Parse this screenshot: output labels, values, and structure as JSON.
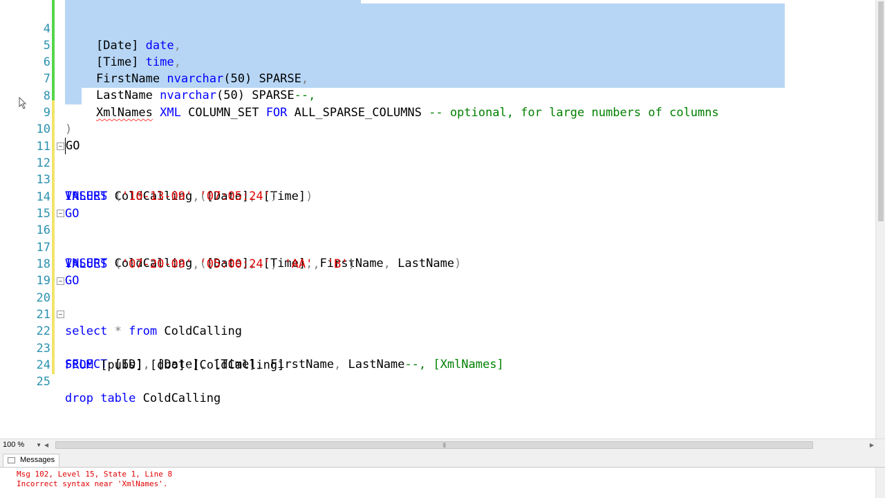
{
  "editor": {
    "lines": [
      {
        "num": "4",
        "top": true
      },
      {
        "num": "5"
      },
      {
        "num": "6"
      },
      {
        "num": "7"
      },
      {
        "num": "8"
      },
      {
        "num": "9"
      },
      {
        "num": "10"
      },
      {
        "num": "11"
      },
      {
        "num": "12"
      },
      {
        "num": "13"
      },
      {
        "num": "14"
      },
      {
        "num": "15"
      },
      {
        "num": "16"
      },
      {
        "num": "17"
      },
      {
        "num": "18"
      },
      {
        "num": "19"
      },
      {
        "num": "20"
      },
      {
        "num": "21"
      },
      {
        "num": "22"
      },
      {
        "num": "23"
      },
      {
        "num": "24"
      },
      {
        "num": "25"
      }
    ],
    "tokens": {
      "l4": [
        "[Date] ",
        "date",
        ","
      ],
      "l5": [
        "[Time] ",
        "time",
        ","
      ],
      "l6": [
        "FirstName ",
        "nvarchar",
        "(50) ",
        "SPARSE",
        ","
      ],
      "l7": [
        "LastName ",
        "nvarchar",
        "(50) ",
        "SPARSE",
        "--,"
      ],
      "l8": [
        "XmlNames",
        " ",
        "XML",
        " COLUMN_SET ",
        "FOR",
        " ALL_SPARSE_COLUMNS ",
        "-- optional, for large numbers of columns"
      ],
      "l9": [
        ")"
      ],
      "l10": [
        "GO"
      ],
      "l12": [
        "INSERT",
        " ColdCalling ",
        "(",
        "[Date]",
        ", ",
        "[Time]",
        ")"
      ],
      "l13": [
        "VALUES",
        " (",
        "'10-13-09'",
        ",",
        "'07:05:24'",
        ")"
      ],
      "l14": [
        "GO"
      ],
      "l16": [
        "INSERT",
        " ColdCalling ",
        "(",
        "[Date]",
        ", ",
        "[Time]",
        ", ",
        "FirstName",
        ", ",
        "LastName",
        ")"
      ],
      "l17": [
        "VALUES",
        " (",
        "'07-20-09'",
        ",",
        "'05:00:24'",
        ", ",
        "'AA'",
        ", ",
        "'B'",
        ")"
      ],
      "l18": [
        "GO"
      ],
      "l20": [
        "select",
        " ",
        "*",
        " ",
        "from",
        " ColdCalling"
      ],
      "l22": [
        "SELECT",
        " [ID]",
        ", ",
        "[Date]",
        ", ",
        "[Time]",
        ", ",
        "FirstName",
        ", ",
        "LastName",
        "--, [XmlNames]"
      ],
      "l23": [
        "FROM",
        " [pubs]",
        ".",
        "[dbo]",
        ".",
        "[ColdCalling]"
      ],
      "l25": [
        "drop",
        " ",
        "table",
        " ColdCalling"
      ]
    }
  },
  "status": {
    "zoom": "100 %",
    "zoom_arrow": "▼",
    "scroll_left": "◀",
    "scroll_right": "▶",
    "grip": "⫴"
  },
  "results": {
    "tab_label": "Messages",
    "messages": [
      "Msg 102, Level 15, State 1, Line 8",
      "Incorrect syntax near 'XmlNames'."
    ]
  },
  "colors": {
    "keyword": "#0000ff",
    "string": "#e00000",
    "comment": "#008000",
    "line_number": "#2b91af",
    "selection": "#b7d6f5",
    "error": "#e00000"
  },
  "icons": [
    "fold-minus-icon",
    "mouse-cursor-icon",
    "messages-icon",
    "scroll-left-icon",
    "scroll-right-icon",
    "dropdown-arrow-icon"
  ]
}
